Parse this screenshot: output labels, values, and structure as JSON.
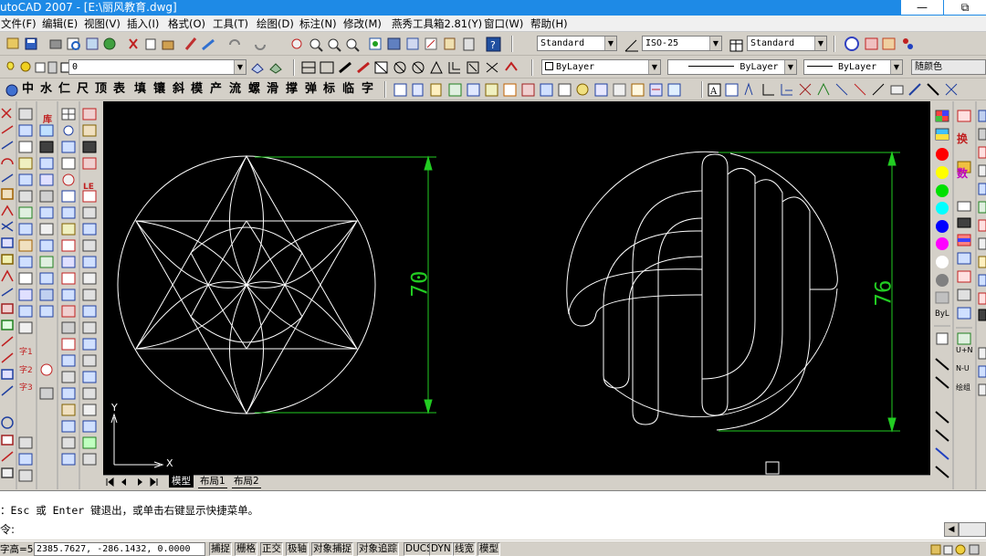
{
  "window": {
    "title": "utoCAD 2007 - [E:\\丽风教育.dwg]",
    "min_label": "—",
    "restore_label": "⧉"
  },
  "menu": [
    "文件(F)",
    "编辑(E)",
    "视图(V)",
    "插入(I)",
    "格式(O)",
    "工具(T)",
    "绘图(D)",
    "标注(N)",
    "修改(M)",
    "燕秀工具箱2.81(Y)",
    "窗口(W)",
    "帮助(H)"
  ],
  "toolbar": {
    "text_style": "Standard",
    "dim_style": "ISO-25",
    "table_style": "Standard",
    "layer_current": "0",
    "color": "ByLayer",
    "linetype": "ByLayer",
    "lineweight": "ByLayer",
    "plot_style": "随颜色"
  },
  "yanxiu_toolbar": [
    "中",
    "水",
    "仁",
    "尺",
    "顶",
    "表",
    "填",
    "镶",
    "斜",
    "模",
    "产",
    "流",
    "螺",
    "滑",
    "撑",
    "弹",
    "标",
    "临",
    "字"
  ],
  "left_palette_labels": [
    "库",
    "字1",
    "字2",
    "字3",
    "LE"
  ],
  "right_palette_labels": [
    "换",
    "数",
    "ByL",
    "U+N",
    "N-U",
    "绘组"
  ],
  "drawing": {
    "dim_left": "70",
    "dim_right": "76",
    "ucs_x": "X",
    "ucs_y": "Y"
  },
  "colors": {
    "canvas": "#000000",
    "geometry": "#ffffff",
    "dimension": "#22cc22",
    "titlebar": "#1e8ae6"
  },
  "layout_tabs": [
    "模型",
    "布局1",
    "布局2"
  ],
  "command": {
    "history": "Esc 或 Enter 键退出，或单击右键显示快捷菜单。",
    "prompt": "令:",
    "history_prefix": "："
  },
  "status": {
    "left_label": "字高=5",
    "coords": "2385.7627, -286.1432, 0.0000",
    "toggles": [
      "捕捉",
      "栅格",
      "正交",
      "极轴",
      "对象捕捉",
      "对象追踪",
      "DUCS",
      "DYN",
      "线宽",
      "模型"
    ]
  }
}
